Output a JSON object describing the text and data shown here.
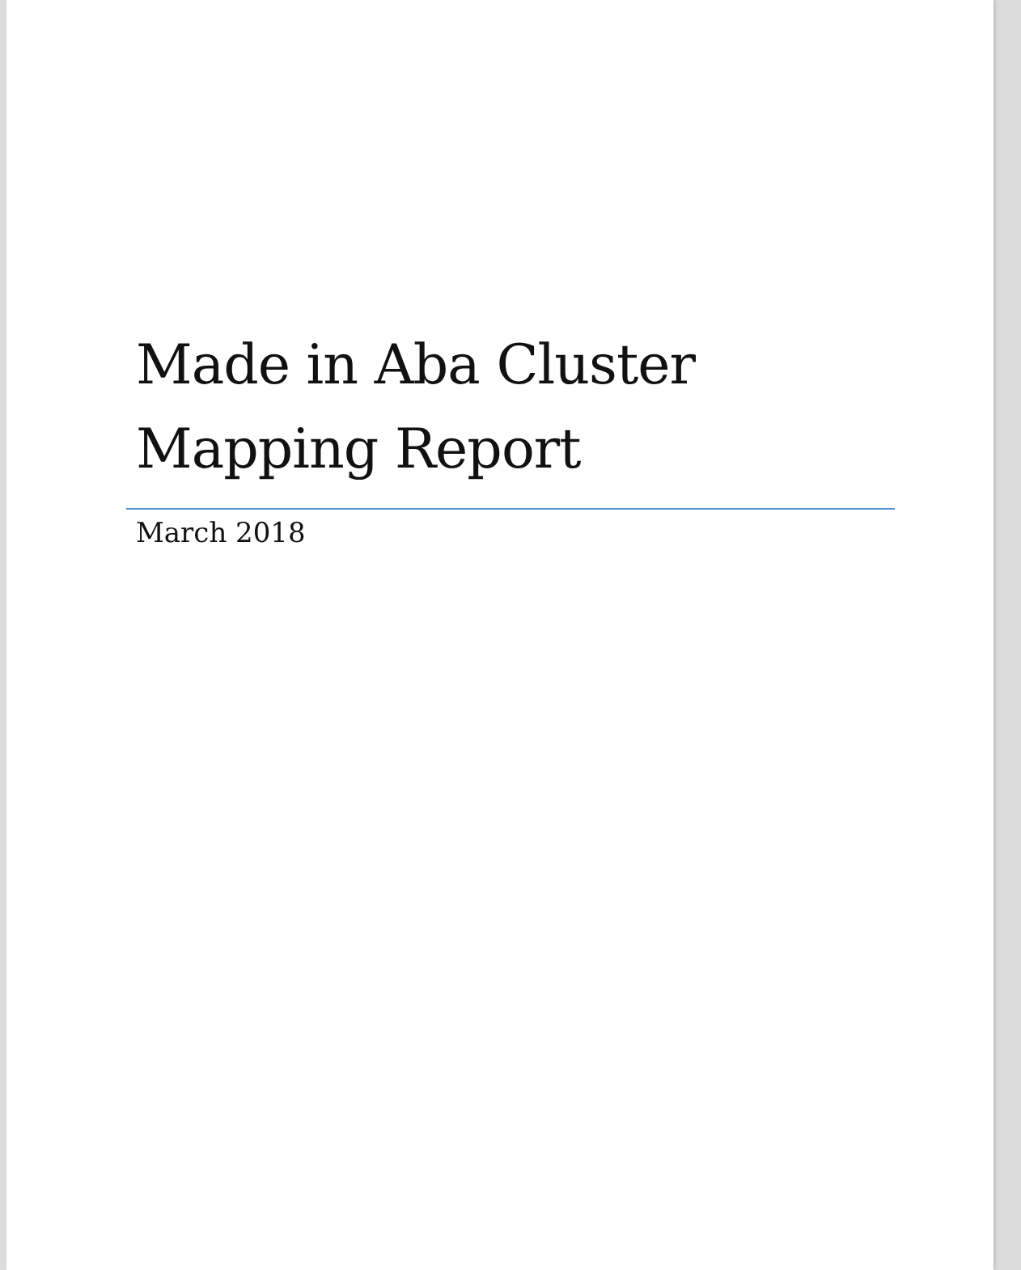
{
  "document": {
    "title_lines": [
      "Made in Aba Cluster",
      "Mapping Report"
    ],
    "subtitle": "March 2018"
  }
}
